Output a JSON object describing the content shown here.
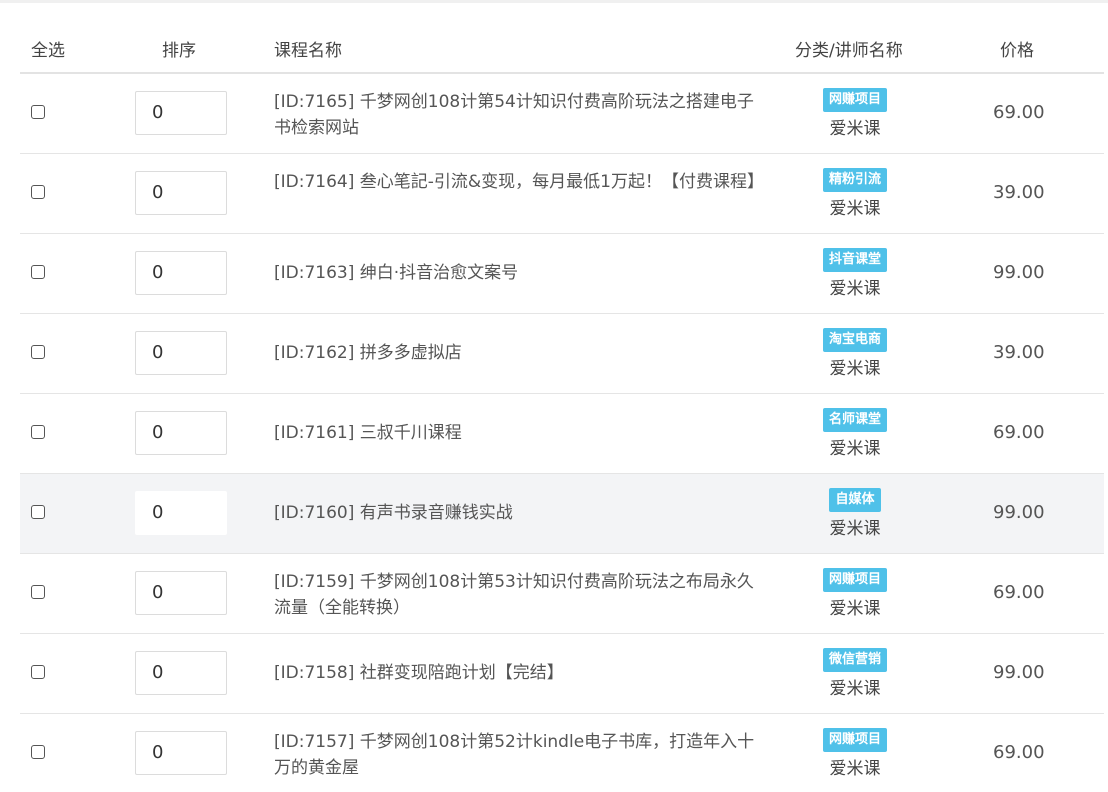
{
  "table": {
    "headers": {
      "select_all": "全选",
      "sort": "排序",
      "course_name": "课程名称",
      "category_teacher": "分类/讲师名称",
      "price": "价格"
    },
    "rows": [
      {
        "sort": "0",
        "name": "[ID:7165] 千梦网创108计第54计知识付费高阶玩法之搭建电子书检索网站",
        "category": "网赚项目",
        "teacher": "爱米课",
        "price": "69.00"
      },
      {
        "sort": "0",
        "name": "[ID:7164] 叁心笔記-引流&变现，每月最低1万起！【付费课程】",
        "category": "精粉引流",
        "teacher": "爱米课",
        "price": "39.00"
      },
      {
        "sort": "0",
        "name": "[ID:7163] 绅白·抖音治愈文案号",
        "category": "抖音课堂",
        "teacher": "爱米课",
        "price": "99.00"
      },
      {
        "sort": "0",
        "name": "[ID:7162] 拼多多虚拟店",
        "category": "淘宝电商",
        "teacher": "爱米课",
        "price": "39.00"
      },
      {
        "sort": "0",
        "name": "[ID:7161] 三叔千川课程",
        "category": "名师课堂",
        "teacher": "爱米课",
        "price": "69.00"
      },
      {
        "sort": "0",
        "name": "[ID:7160] 有声书录音赚钱实战",
        "category": "自媒体",
        "teacher": "爱米课",
        "price": "99.00"
      },
      {
        "sort": "0",
        "name": "[ID:7159] 千梦网创108计第53计知识付费高阶玩法之布局永久流量（全能转换）",
        "category": "网赚项目",
        "teacher": "爱米课",
        "price": "69.00"
      },
      {
        "sort": "0",
        "name": "[ID:7158] 社群变现陪跑计划【完结】",
        "category": "微信营销",
        "teacher": "爱米课",
        "price": "99.00"
      },
      {
        "sort": "0",
        "name": "[ID:7157] 千梦网创108计第52计kindle电子书库，打造年入十万的黄金屋",
        "category": "网赚项目",
        "teacher": "爱米课",
        "price": "69.00"
      }
    ]
  },
  "colors": {
    "badge": "#4fc1e9",
    "highlight_row": "#f3f4f6"
  }
}
